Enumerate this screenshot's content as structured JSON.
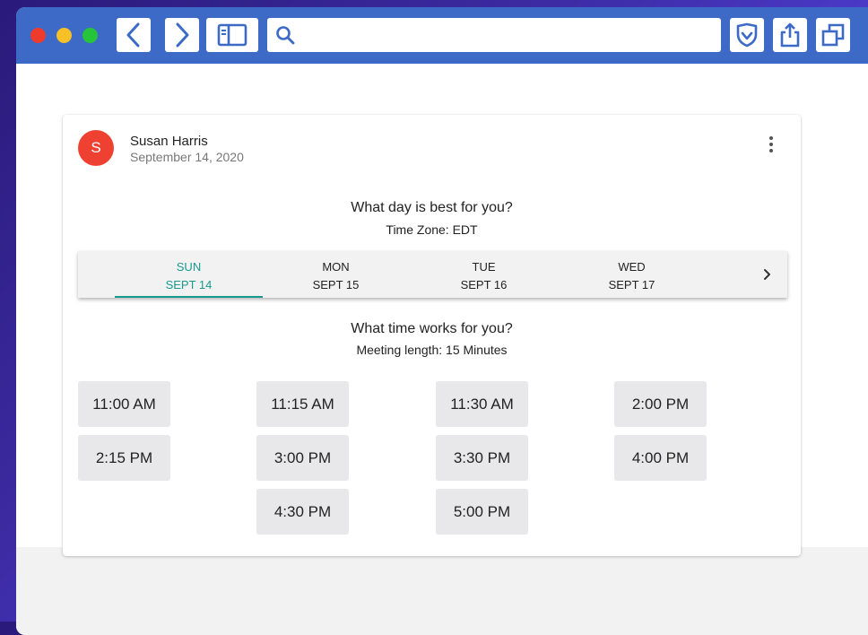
{
  "browser": {
    "address_value": "",
    "address_placeholder": ""
  },
  "post": {
    "avatar_letter": "S",
    "author": "Susan Harris",
    "date": "September 14, 2020"
  },
  "day_picker": {
    "question": "What day is best for you?",
    "timezone": "Time Zone: EDT",
    "days": [
      {
        "name": "SUN",
        "date": "SEPT 14",
        "selected": true
      },
      {
        "name": "MON",
        "date": "SEPT 15",
        "selected": false
      },
      {
        "name": "TUE",
        "date": "SEPT 16",
        "selected": false
      },
      {
        "name": "WED",
        "date": "SEPT 17",
        "selected": false
      }
    ]
  },
  "time_picker": {
    "question": "What time works for you?",
    "meeting_length": "Meeting length: 15 Minutes",
    "slots": [
      "11:00 AM",
      "11:15 AM",
      "11:30 AM",
      "2:00 PM",
      "2:15 PM",
      "3:00 PM",
      "3:30 PM",
      "4:00 PM",
      "4:30 PM",
      "5:00 PM"
    ]
  },
  "colors": {
    "toolbar": "#3c6ac6",
    "accent": "#1a9a8f",
    "avatar": "#ef4132"
  }
}
